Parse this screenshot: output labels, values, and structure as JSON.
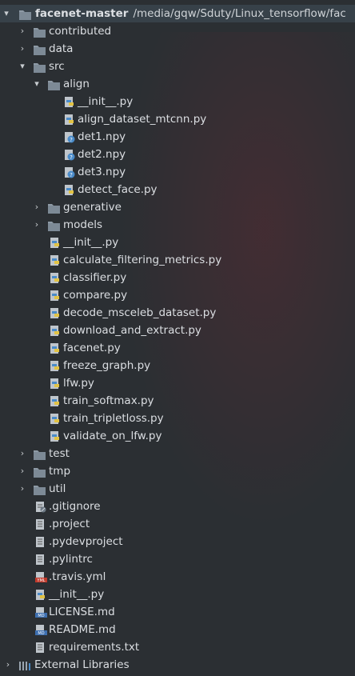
{
  "project_tree": {
    "root": {
      "name": "facenet-master",
      "path": "/media/gqw/Sduty/Linux_tensorflow/fac"
    },
    "items": [
      {
        "label": "contributed",
        "icon": "folder-icon",
        "expanded": false
      },
      {
        "label": "data",
        "icon": "folder-icon",
        "expanded": false
      },
      {
        "label": "src",
        "icon": "folder-icon",
        "expanded": true
      },
      {
        "label": "align",
        "icon": "folder-icon",
        "expanded": true
      },
      {
        "label": "__init__.py",
        "icon": "python-file-icon"
      },
      {
        "label": "align_dataset_mtcnn.py",
        "icon": "python-file-icon"
      },
      {
        "label": "det1.npy",
        "icon": "unknown-file-icon"
      },
      {
        "label": "det2.npy",
        "icon": "unknown-file-icon"
      },
      {
        "label": "det3.npy",
        "icon": "unknown-file-icon"
      },
      {
        "label": "detect_face.py",
        "icon": "python-file-icon"
      },
      {
        "label": "generative",
        "icon": "folder-icon",
        "expanded": false
      },
      {
        "label": "models",
        "icon": "folder-icon",
        "expanded": false
      },
      {
        "label": "__init__.py",
        "icon": "python-file-icon"
      },
      {
        "label": "calculate_filtering_metrics.py",
        "icon": "python-file-icon"
      },
      {
        "label": "classifier.py",
        "icon": "python-file-icon"
      },
      {
        "label": "compare.py",
        "icon": "python-file-icon"
      },
      {
        "label": "decode_msceleb_dataset.py",
        "icon": "python-file-icon"
      },
      {
        "label": "download_and_extract.py",
        "icon": "python-file-icon"
      },
      {
        "label": "facenet.py",
        "icon": "python-file-icon"
      },
      {
        "label": "freeze_graph.py",
        "icon": "python-file-icon"
      },
      {
        "label": "lfw.py",
        "icon": "python-file-icon"
      },
      {
        "label": "train_softmax.py",
        "icon": "python-file-icon"
      },
      {
        "label": "train_tripletloss.py",
        "icon": "python-file-icon"
      },
      {
        "label": "validate_on_lfw.py",
        "icon": "python-file-icon"
      },
      {
        "label": "test",
        "icon": "folder-icon",
        "expanded": false
      },
      {
        "label": "tmp",
        "icon": "folder-icon",
        "expanded": false
      },
      {
        "label": "util",
        "icon": "folder-icon",
        "expanded": false
      },
      {
        "label": ".gitignore",
        "icon": "gitignore-file-icon"
      },
      {
        "label": ".project",
        "icon": "text-file-icon"
      },
      {
        "label": ".pydevproject",
        "icon": "text-file-icon"
      },
      {
        "label": ".pylintrc",
        "icon": "text-file-icon"
      },
      {
        "label": ".travis.yml",
        "icon": "yaml-file-icon",
        "badge": "YML"
      },
      {
        "label": "__init__.py",
        "icon": "python-file-icon"
      },
      {
        "label": "LICENSE.md",
        "icon": "markdown-file-icon",
        "badge": "MD"
      },
      {
        "label": "README.md",
        "icon": "markdown-file-icon",
        "badge": "MD"
      },
      {
        "label": "requirements.txt",
        "icon": "text-file-icon"
      },
      {
        "label": "External Libraries",
        "icon": "libraries-icon",
        "expanded": false
      }
    ]
  },
  "colors": {
    "background": "#2b2f33",
    "selection": "#374149",
    "folder": "#8e9aa6",
    "python_blue": "#4a8bc9",
    "python_yellow": "#e2c344",
    "text": "#dcdfe3"
  }
}
